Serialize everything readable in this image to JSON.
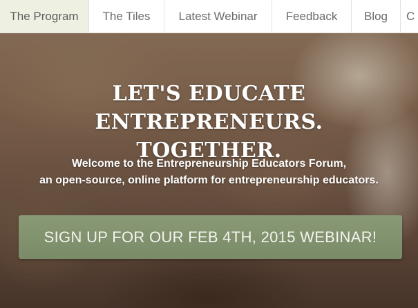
{
  "nav": {
    "items": [
      {
        "label": "The Program",
        "active": true
      },
      {
        "label": "The Tiles"
      },
      {
        "label": "Latest Webinar"
      },
      {
        "label": "Feedback"
      },
      {
        "label": "Blog"
      },
      {
        "label": "C"
      }
    ]
  },
  "hero": {
    "headline_line1": "LET'S EDUCATE ENTREPRENEURS.",
    "headline_line2": "TOGETHER.",
    "welcome_line1": "Welcome to the Entrepreneurship Educators Forum,",
    "welcome_line2": "an open-source, online platform for entrepreneurship educators.",
    "cta_label": "SIGN UP FOR OUR FEB 4TH, 2015 WEBINAR!"
  },
  "colors": {
    "nav_active_bg": "#eef0e2",
    "cta_bg": "#7f906c",
    "text_light": "#ffffff"
  }
}
